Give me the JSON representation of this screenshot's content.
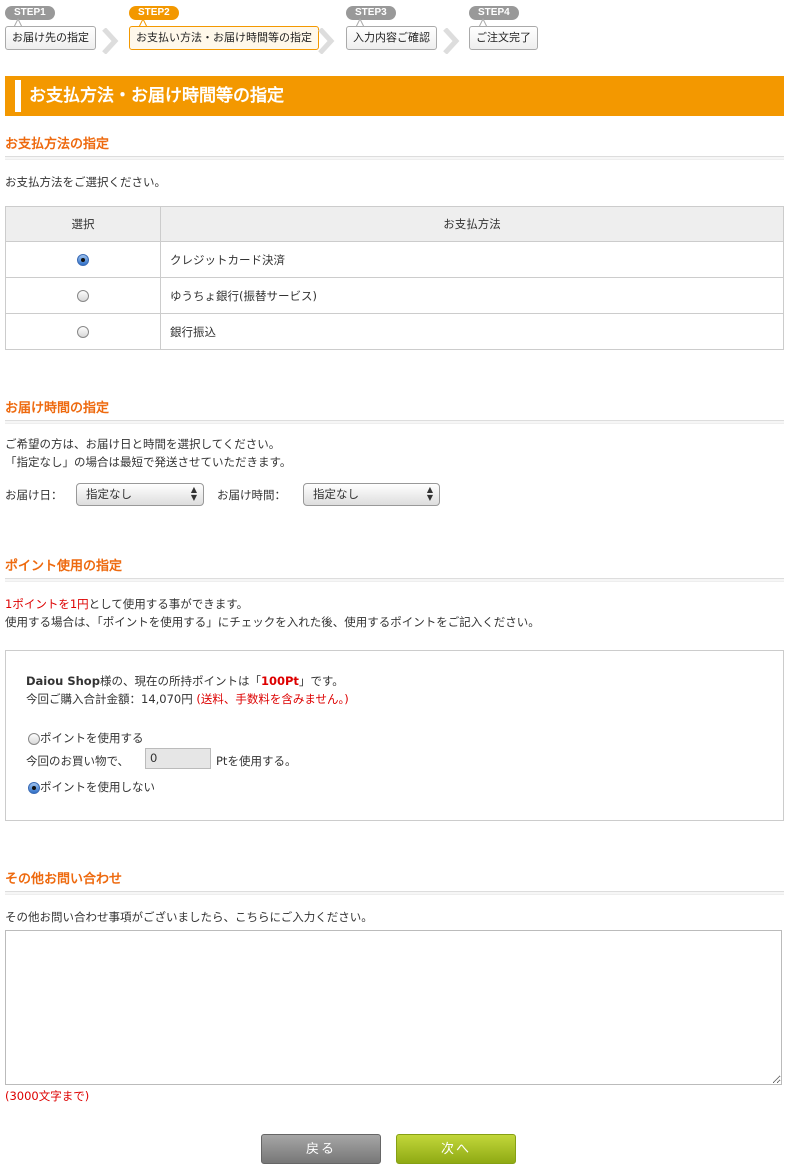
{
  "steps": [
    {
      "tag": "STEP1",
      "label": "お届け先の指定",
      "active": false
    },
    {
      "tag": "STEP2",
      "label": "お支払い方法・お届け時間等の指定",
      "active": true
    },
    {
      "tag": "STEP3",
      "label": "入力内容ご確認",
      "active": false
    },
    {
      "tag": "STEP4",
      "label": "ご注文完了",
      "active": false
    }
  ],
  "page_title": "お支払方法・お届け時間等の指定",
  "payment": {
    "title": "お支払方法の指定",
    "desc": "お支払方法をご選択ください。",
    "col_select": "選択",
    "col_method": "お支払方法",
    "methods": [
      {
        "name": "クレジットカード決済",
        "selected": true
      },
      {
        "name": "ゆうちょ銀行(振替サービス)",
        "selected": false
      },
      {
        "name": "銀行振込",
        "selected": false
      }
    ]
  },
  "delivery": {
    "title": "お届け時間の指定",
    "desc1": "ご希望の方は、お届け日と時間を選択してください。",
    "desc2": "「指定なし」の場合は最短で発送させていただきます。",
    "date_label": "お届け日：",
    "date_value": "指定なし",
    "time_label": "お届け時間：",
    "time_value": "指定なし"
  },
  "points": {
    "title": "ポイント使用の指定",
    "desc1_red": "1ポイントを1円",
    "desc1_rest": "として使用する事ができます。",
    "desc2": "使用する場合は、「ポイントを使用する」にチェックを入れた後、使用するポイントをご記入ください。",
    "user_name": "Daiou Shop",
    "owned_prefix": "様の、現在の所持ポイントは「",
    "owned_value": "100Pt",
    "owned_suffix": "」です。",
    "total_label": "今回ご購入合計金額：14,070円",
    "total_note": "(送料、手数料を含みません。)",
    "use_label": "ポイントを使用する",
    "use_prefix": "今回のお買い物で、",
    "use_value": "0",
    "use_suffix": "Ptを使用する。",
    "nouse_label": "ポイントを使用しない",
    "use_selected": false
  },
  "inquiry": {
    "title": "その他お問い合わせ",
    "desc": "その他お問い合わせ事項がございましたら、こちらにご入力ください。",
    "limit": "(3000文字まで)"
  },
  "buttons": {
    "back": "戻る",
    "next": "次へ"
  },
  "colors": {
    "accent": "#f39800",
    "section_title": "#ee6a0f",
    "next_button": "#a0bc1e"
  }
}
